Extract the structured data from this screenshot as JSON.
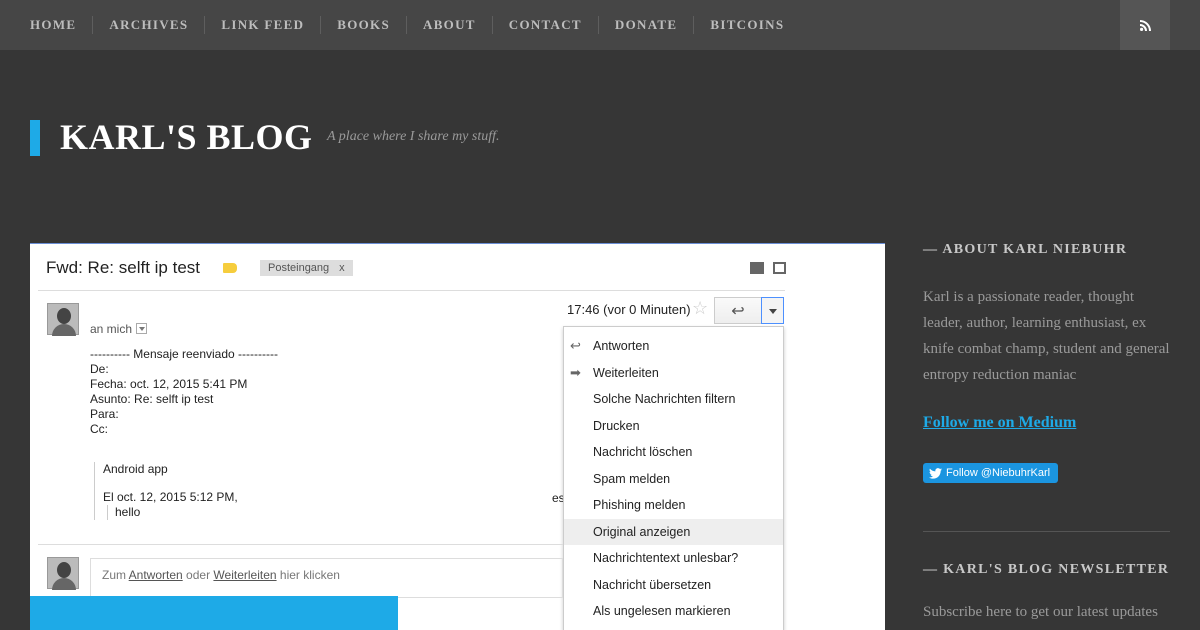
{
  "nav": {
    "items": [
      "HOME",
      "ARCHIVES",
      "LINK FEED",
      "BOOKS",
      "ABOUT",
      "CONTACT",
      "DONATE",
      "BITCOINS"
    ],
    "rss_icon": "rss-icon"
  },
  "header": {
    "title": "KARL'S BLOG",
    "tagline": "A place where I share my stuff."
  },
  "screenshot": {
    "subject": "Fwd: Re: selft ip test",
    "label": "Posteingang",
    "label_close": "x",
    "sender": "an mich",
    "time": "17:46 (vor 0 Minuten)",
    "body_lines": [
      "---------- Mensaje reenviado ----------",
      "De:",
      "Fecha: oct. 12, 2015 5:41 PM",
      "Asunto: Re: selft ip test",
      "Para:",
      "Cc:"
    ],
    "quote_app": "Android app",
    "quote_date": "El oct. 12, 2015 5:12 PM,",
    "quote_text": "hello",
    "fragment": "es",
    "menu_items": [
      "Antworten",
      "Weiterleiten",
      "Solche Nachrichten filtern",
      "Drucken",
      "Nachricht löschen",
      "Spam melden",
      "Phishing melden",
      "Original anzeigen",
      "Nachrichtentext unlesbar?",
      "Nachricht übersetzen",
      "Als ungelesen markieren"
    ],
    "highlighted_menu_item": "Original anzeigen",
    "reply_prefix": "Zum",
    "reply_link1": "Antworten",
    "reply_mid": "oder",
    "reply_link2": "Weiterleiten",
    "reply_suffix": "hier klicken"
  },
  "sidebar": {
    "about_title": "— ABOUT KARL NIEBUHR",
    "about_text": "Karl is a passionate reader, thought leader, author, learning enthusiast, ex knife combat champ, student and general entropy reduction maniac",
    "medium_link": "Follow me on Medium",
    "twitter_button": "Follow @NiebuhrKarl",
    "newsletter_title": "— KARL'S BLOG NEWSLETTER",
    "newsletter_text": "Subscribe here to get our latest updates"
  },
  "colors": {
    "accent": "#1eaae7",
    "background": "#363636",
    "nav_bg": "#464646",
    "twitter": "#1b95e0"
  }
}
